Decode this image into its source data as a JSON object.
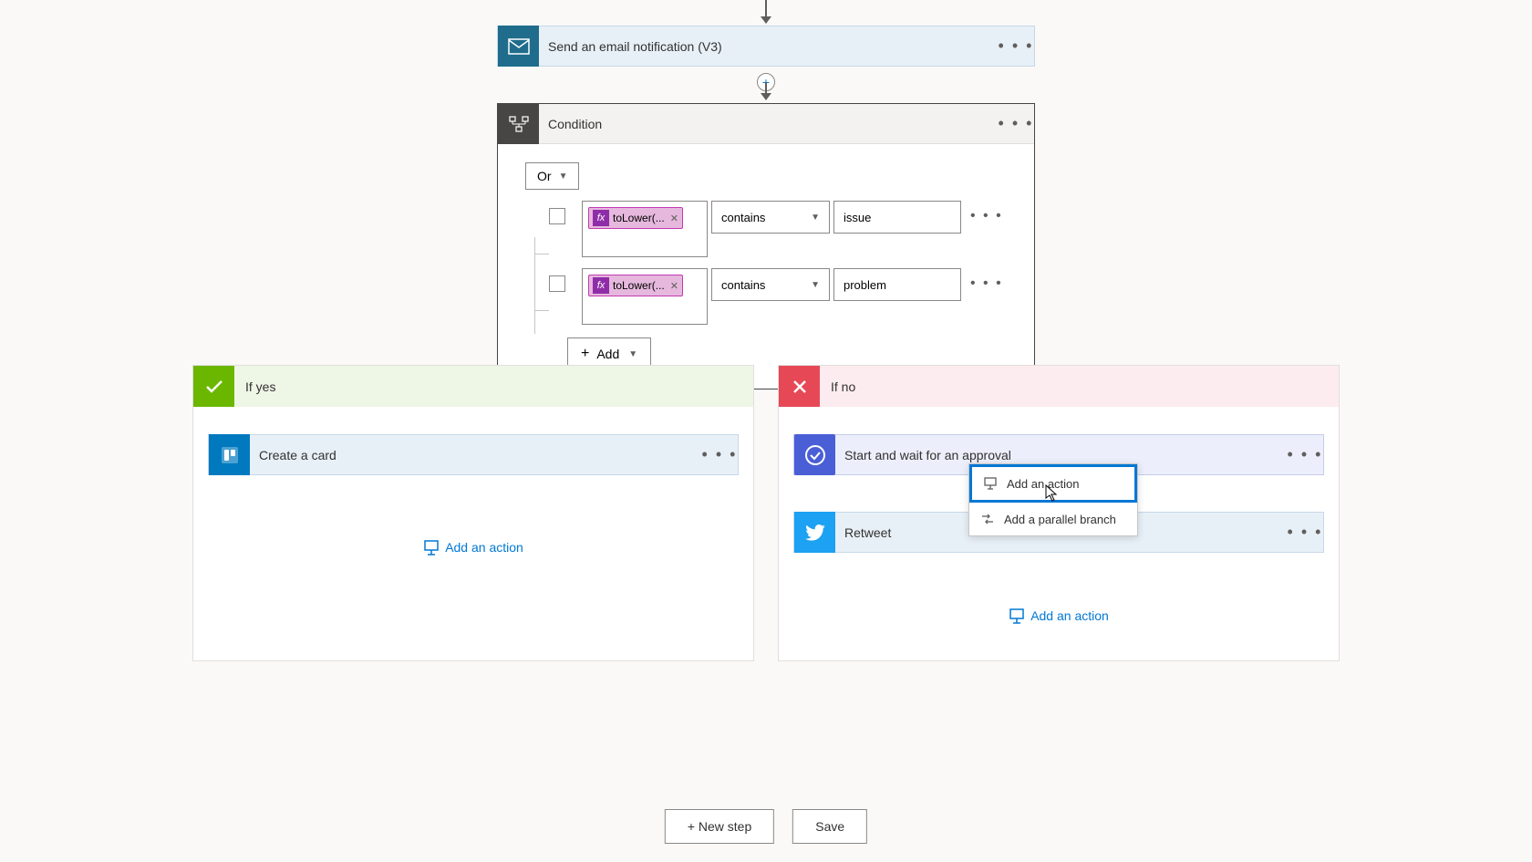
{
  "actions": {
    "email": {
      "title": "Send an email notification (V3)"
    },
    "condition": {
      "title": "Condition"
    },
    "trello": {
      "title": "Create a card"
    },
    "approval": {
      "title": "Start and wait for an approval"
    },
    "retweet": {
      "title": "Retweet"
    }
  },
  "condition": {
    "logic": "Or",
    "rows": [
      {
        "fx": "toLower(...",
        "op": "contains",
        "val": "issue"
      },
      {
        "fx": "toLower(...",
        "op": "contains",
        "val": "problem"
      }
    ],
    "add_label": "Add"
  },
  "branches": {
    "yes": {
      "title": "If yes",
      "add_action": "Add an action"
    },
    "no": {
      "title": "If no",
      "add_action": "Add an action"
    }
  },
  "popup": {
    "add_action": "Add an action",
    "add_parallel": "Add a parallel branch"
  },
  "buttons": {
    "new_step": "+ New step",
    "save": "Save"
  },
  "menu_dots": "• • •"
}
